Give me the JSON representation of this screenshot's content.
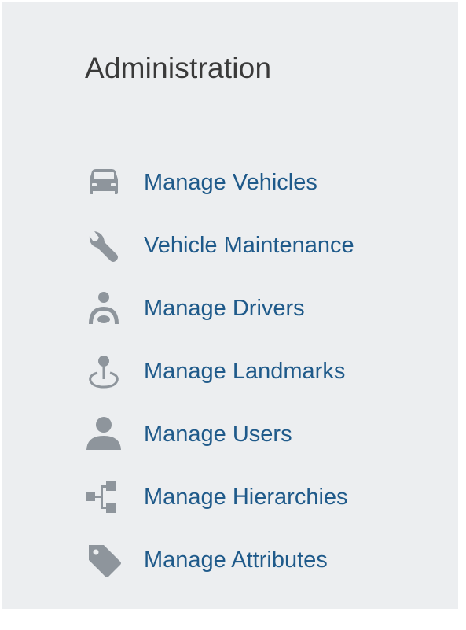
{
  "panel": {
    "title": "Administration",
    "items": [
      {
        "label": "Manage Vehicles",
        "icon": "car-icon"
      },
      {
        "label": "Vehicle Maintenance",
        "icon": "wrench-icon"
      },
      {
        "label": "Manage Drivers",
        "icon": "driver-icon"
      },
      {
        "label": "Manage Landmarks",
        "icon": "landmark-pin-icon"
      },
      {
        "label": "Manage Users",
        "icon": "user-icon"
      },
      {
        "label": "Manage Hierarchies",
        "icon": "hierarchy-icon"
      },
      {
        "label": "Manage Attributes",
        "icon": "tag-icon"
      }
    ]
  },
  "colors": {
    "background": "#eceef0",
    "title_text": "#3a3a3a",
    "link_text": "#1f5a8a",
    "icon": "#8e959c"
  }
}
